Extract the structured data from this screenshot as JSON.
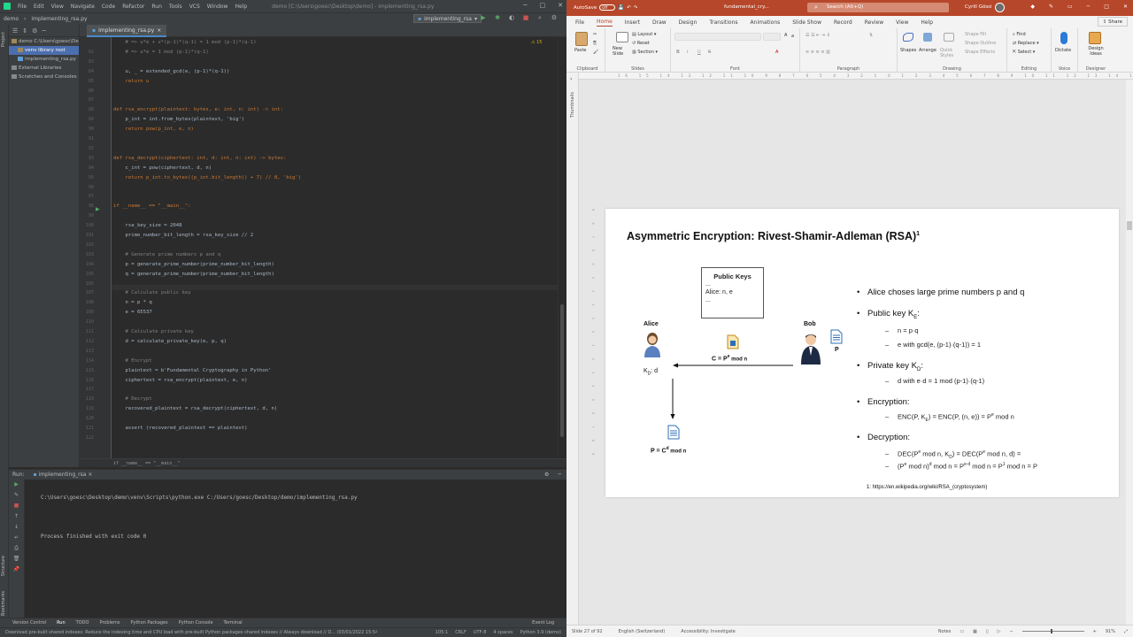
{
  "ide": {
    "menu": [
      "File",
      "Edit",
      "View",
      "Navigate",
      "Code",
      "Refactor",
      "Run",
      "Tools",
      "VCS",
      "Window",
      "Help"
    ],
    "window_title": "demo [C:\\Users\\goesc\\Desktop\\demo] - implementing_rsa.py",
    "breadcrumb_project": "demo",
    "breadcrumb_file": "implementing_rsa.py",
    "run_config": "implementing_rsa",
    "project_tree": [
      {
        "label": "demo  C:\\Users\\goesc\\De",
        "selected": false,
        "indent": 0
      },
      {
        "label": "venv  library root",
        "selected": true,
        "indent": 1
      },
      {
        "label": "implementing_rsa.py",
        "selected": false,
        "indent": 1
      },
      {
        "label": "External Libraries",
        "selected": false,
        "indent": 0
      },
      {
        "label": "Scratches and Consoles",
        "selected": false,
        "indent": 0
      }
    ],
    "editor_tab": "implementing_rsa.py",
    "warning_count": "15",
    "code_lines": [
      {
        "n": "",
        "t": "    # => u*e + v*(p-1)*(q-1) = 1 mod (p-1)*(q-1)",
        "c": "#808080"
      },
      {
        "n": "82",
        "t": "    # => u*e = 1 mod (p-1)*(q-1)",
        "c": "#808080"
      },
      {
        "n": "83",
        "t": "",
        "c": "#a9b7c6"
      },
      {
        "n": "84",
        "t": "    u, _ = extended_gcd(e, (p-1)*(q-1))",
        "c": "#a9b7c6"
      },
      {
        "n": "85",
        "t": "    return u",
        "c": "#cc7832"
      },
      {
        "n": "86",
        "t": "",
        "c": "#a9b7c6"
      },
      {
        "n": "87",
        "t": "",
        "c": "#a9b7c6"
      },
      {
        "n": "88",
        "t": "def rsa_encrypt(plaintext: bytes, e: int, n: int) -> int:",
        "c": "#cc7832"
      },
      {
        "n": "89",
        "t": "    p_int = int.from_bytes(plaintext, 'big')",
        "c": "#a9b7c6"
      },
      {
        "n": "90",
        "t": "    return pow(p_int, e, n)",
        "c": "#cc7832"
      },
      {
        "n": "91",
        "t": "",
        "c": "#a9b7c6"
      },
      {
        "n": "92",
        "t": "",
        "c": "#a9b7c6"
      },
      {
        "n": "93",
        "t": "def rsa_decrypt(ciphertext: int, d: int, n: int) -> bytes:",
        "c": "#cc7832"
      },
      {
        "n": "94",
        "t": "    c_int = pow(ciphertext, d, n)",
        "c": "#a9b7c6"
      },
      {
        "n": "95",
        "t": "    return p_int.to_bytes((p_int.bit_length() + 7) // 8, 'big')",
        "c": "#cc7832"
      },
      {
        "n": "96",
        "t": "",
        "c": "#a9b7c6"
      },
      {
        "n": "97",
        "t": "",
        "c": "#a9b7c6"
      },
      {
        "n": "98",
        "t": "if __name__ == \"__main__\":",
        "c": "#cc7832"
      },
      {
        "n": "99",
        "t": "",
        "c": "#a9b7c6"
      },
      {
        "n": "100",
        "t": "    rsa_key_size = 2048",
        "c": "#a9b7c6"
      },
      {
        "n": "101",
        "t": "    prime_number_bit_length = rsa_key_size // 2",
        "c": "#a9b7c6"
      },
      {
        "n": "102",
        "t": "",
        "c": "#a9b7c6"
      },
      {
        "n": "103",
        "t": "    # Generate prime numbers p and q",
        "c": "#808080"
      },
      {
        "n": "104",
        "t": "    p = generate_prime_number(prime_number_bit_length)",
        "c": "#a9b7c6"
      },
      {
        "n": "105",
        "t": "    q = generate_prime_number(prime_number_bit_length)",
        "c": "#a9b7c6"
      },
      {
        "n": "105",
        "t": "",
        "c": "#a9b7c6"
      },
      {
        "n": "107",
        "t": "    # Calculate public key",
        "c": "#808080"
      },
      {
        "n": "108",
        "t": "    n = p * q",
        "c": "#a9b7c6"
      },
      {
        "n": "109",
        "t": "    e = 65537",
        "c": "#a9b7c6"
      },
      {
        "n": "110",
        "t": "",
        "c": "#a9b7c6"
      },
      {
        "n": "111",
        "t": "    # Calculate private key",
        "c": "#808080"
      },
      {
        "n": "112",
        "t": "    d = calculate_private_key(e, p, q)",
        "c": "#a9b7c6"
      },
      {
        "n": "113",
        "t": "",
        "c": "#a9b7c6"
      },
      {
        "n": "114",
        "t": "    # Encrypt",
        "c": "#808080"
      },
      {
        "n": "115",
        "t": "    plaintext = b'Fundamental Cryptography in Python'",
        "c": "#a9b7c6"
      },
      {
        "n": "116",
        "t": "    ciphertext = rsa_encrypt(plaintext, e, n)",
        "c": "#a9b7c6"
      },
      {
        "n": "117",
        "t": "",
        "c": "#a9b7c6"
      },
      {
        "n": "118",
        "t": "    # Decrypt",
        "c": "#808080"
      },
      {
        "n": "119",
        "t": "    recovered_plaintext = rsa_decrypt(ciphertext, d, n)",
        "c": "#a9b7c6"
      },
      {
        "n": "120",
        "t": "",
        "c": "#a9b7c6"
      },
      {
        "n": "121",
        "t": "    assert (recovered_plaintext == plaintext)",
        "c": "#a9b7c6"
      },
      {
        "n": "122",
        "t": "",
        "c": "#a9b7c6"
      }
    ],
    "breadcrumb_footer": "if __name__ == \"__main__\"",
    "run_label": "Run:",
    "run_tab": "implementing_rsa",
    "run_command": "C:\\Users\\goesc\\Desktop\\demo\\venv\\Scripts\\python.exe C:/Users/goesc/Desktop/demo/implementing_rsa.py",
    "run_result": "Process finished with exit code 0",
    "bottom_tabs": [
      "Version Control",
      "Run",
      "TODO",
      "Problems",
      "Python Packages",
      "Python Console",
      "Terminal"
    ],
    "event_log": "Event Log",
    "status_message": "Download pre-built shared indexes: Reduce the indexing time and CPU load with pre-built Python packages shared indexes // Always download // D... (03/01/2022 15:54)",
    "status_right": [
      "105:1",
      "CRLF",
      "UTF-8",
      "4 spaces",
      "Python 3.9 (demo)"
    ]
  },
  "ppt": {
    "autosave_label": "AutoSave",
    "autosave_state": "Off",
    "file_name": "fundamental_cry...",
    "search_placeholder": "Search (Alt+Q)",
    "user_name": "Cyrill Gössi",
    "tabs": [
      "File",
      "Home",
      "Insert",
      "Draw",
      "Design",
      "Transitions",
      "Animations",
      "Slide Show",
      "Record",
      "Review",
      "View",
      "Help"
    ],
    "active_tab": "Home",
    "share_label": "Share",
    "ribbon_groups": [
      {
        "label": "Clipboard",
        "items": [
          "Paste"
        ]
      },
      {
        "label": "Slides",
        "items": [
          "New Slide",
          "Layout",
          "Reset",
          "Section"
        ]
      },
      {
        "label": "Font",
        "items": [
          "B",
          "I",
          "U",
          "S"
        ]
      },
      {
        "label": "Paragraph",
        "items": []
      },
      {
        "label": "Drawing",
        "items": [
          "Shapes",
          "Arrange",
          "Quick Styles",
          "Shape Fill",
          "Shape Outline",
          "Shape Effects"
        ]
      },
      {
        "label": "Editing",
        "items": [
          "Find",
          "Replace",
          "Select"
        ]
      },
      {
        "label": "Voice",
        "items": [
          "Dictate"
        ]
      },
      {
        "label": "Designer",
        "items": [
          "Design Ideas"
        ]
      }
    ],
    "thumbnails_label": "Thumbnails",
    "slide": {
      "title": "Asymmetric Encryption: Rivest-Shamir-Adleman (RSA)",
      "title_sup": "1",
      "public_keys_title": "Public Keys",
      "public_keys_lines": [
        "...",
        "Alice: n, e",
        "..."
      ],
      "alice_label": "Alice",
      "alice_key": "K",
      "alice_key_sub": "D",
      "alice_key_rest": ": d",
      "bob_label": "Bob",
      "bob_doc_label": "P",
      "cipher_label": "C = P",
      "cipher_sup": "e",
      "cipher_rest": " mod n",
      "result_label": "P = C",
      "result_sup": "d",
      "result_rest": " mod n",
      "bullets": [
        "Alice choses large prime numbers p and q",
        "Public key K",
        "Private key K",
        "Encryption:",
        "Decryption:"
      ],
      "bullet_subs": [
        "E",
        "D"
      ],
      "sub1": "n = p·q",
      "sub2": "e with gcd(e, (p-1)·(q-1)) = 1",
      "sub3": "d with e·d = 1 mod (p-1)·(q-1)",
      "sub4": "ENC(P, K",
      "sub4_sub": "E",
      "sub4_rest": ") = ENC(P, (n, e)) = P",
      "sub4_sup": "e",
      "sub4_end": " mod n",
      "sub5a": "DEC(P",
      "sub5a_sup1": "e",
      "sub5a_mid": " mod n, K",
      "sub5a_sub": "D",
      "sub5a_mid2": ") = DEC(P",
      "sub5a_sup2": "e",
      "sub5a_end": " mod n, d) =",
      "sub5b": "(P",
      "sub5b_sup1": "e",
      "sub5b_mid": " mod n)",
      "sub5b_sup2": "d",
      "sub5b_mid2": " mod n = P",
      "sub5b_sup3": "e·d",
      "sub5b_mid3": " mod n = P",
      "sub5b_sup4": "1",
      "sub5b_end": " mod n = P",
      "footnote": "1: https://en.wikipedia.org/wiki/RSA_(cryptosystem)"
    },
    "status_left": [
      "Slide 27 of 92",
      "English (Switzerland)",
      "Accessibility: Investigate"
    ],
    "status_right": [
      "Notes",
      "91%"
    ]
  },
  "colors": {
    "ppt_accent": "#b7472a",
    "ide_bg": "#2b2b2b",
    "ide_keyword": "#cc7832",
    "ide_comment": "#808080"
  }
}
